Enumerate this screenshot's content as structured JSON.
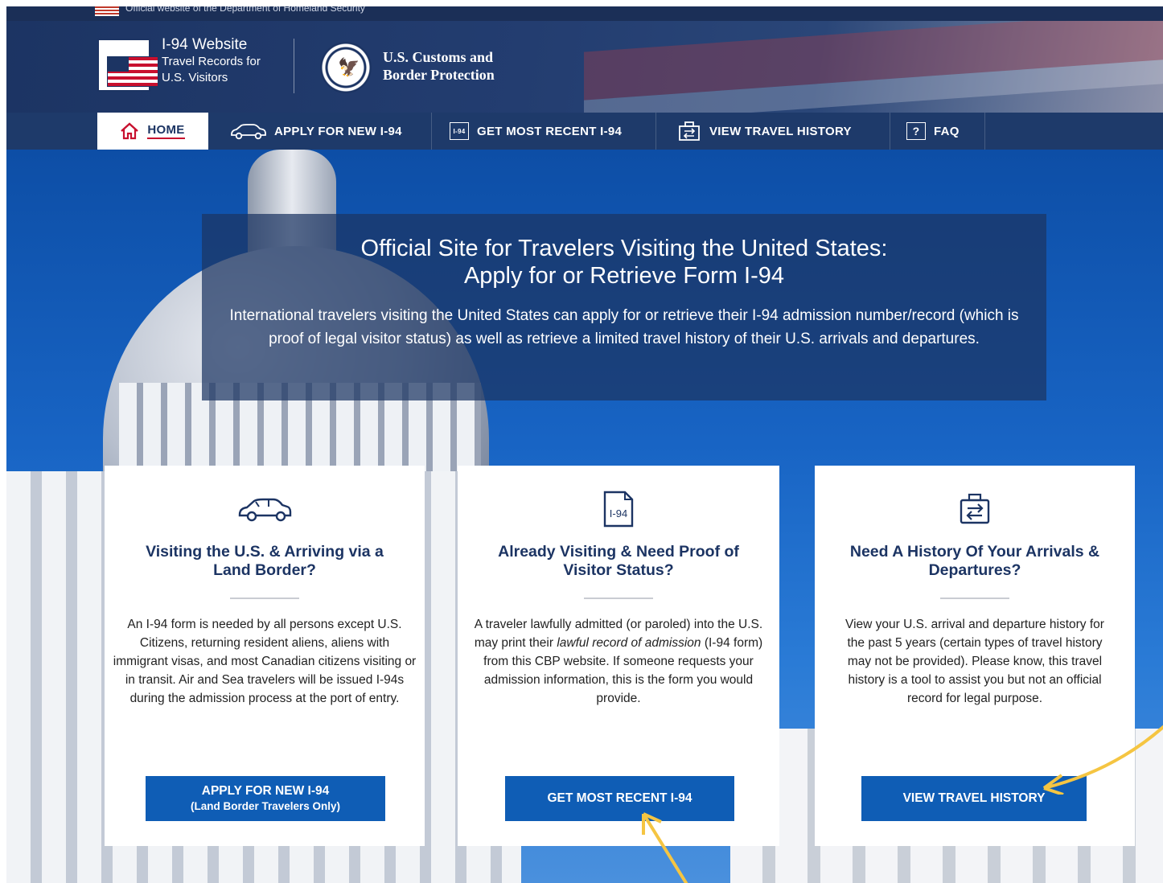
{
  "gov_banner": {
    "text": "Official website of the Department of Homeland Security"
  },
  "header": {
    "site_title": "I-94 Website",
    "site_subtitle_1": "Travel Records for",
    "site_subtitle_2": "U.S. Visitors",
    "agency_line_1": "U.S. Customs and",
    "agency_line_2": "Border Protection"
  },
  "nav": {
    "items": [
      {
        "label": "HOME",
        "icon": "home-icon",
        "active": true
      },
      {
        "label": "APPLY FOR NEW I-94",
        "icon": "car-icon"
      },
      {
        "label": "GET MOST RECENT I-94",
        "icon": "i94-document-icon"
      },
      {
        "label": "VIEW TRAVEL HISTORY",
        "icon": "travel-history-icon"
      },
      {
        "label": "FAQ",
        "icon": "question-icon"
      }
    ]
  },
  "intro": {
    "title_line_1": "Official Site for Travelers Visiting the United States:",
    "title_line_2": "Apply for or Retrieve Form I-94",
    "text": "International travelers visiting the United States can apply for or retrieve their I-94 admission number/record (which is proof of legal visitor status) as well as retrieve a limited travel history of their U.S. arrivals and departures."
  },
  "cards": [
    {
      "icon": "car-icon",
      "title": "Visiting the U.S. & Arriving via a Land Border?",
      "text": "An I-94 form is needed by all persons except U.S. Citizens, returning resident aliens, aliens with immigrant visas, and most Canadian citizens visiting or in transit. Air and Sea travelers will be issued I-94s during the admission process at the port of entry.",
      "button_label": "APPLY FOR NEW I-94",
      "button_sublabel": "(Land Border Travelers Only)"
    },
    {
      "icon": "i94-document-icon",
      "title": "Already Visiting & Need Proof of Visitor Status?",
      "text_before": "A traveler lawfully admitted (or paroled) into the U.S. may print their ",
      "text_emphasis": "lawful record of admission",
      "text_after": " (I-94 form) from this CBP website. If someone requests your admission information, this is the form you would provide.",
      "button_label": "GET MOST RECENT I-94"
    },
    {
      "icon": "travel-history-icon",
      "title": "Need A History Of Your Arrivals & Departures?",
      "text": "View your U.S. arrival and departure history for the past 5 years (certain types of travel history may not be provided). Please know, this travel history is a tool to assist you but not an official record for legal purpose.",
      "button_label": "VIEW TRAVEL HISTORY"
    }
  ],
  "colors": {
    "header_navy": "#1c3463",
    "button_blue": "#0f5db5",
    "active_red": "#c8102e",
    "annotation_yellow": "#f5c542"
  }
}
